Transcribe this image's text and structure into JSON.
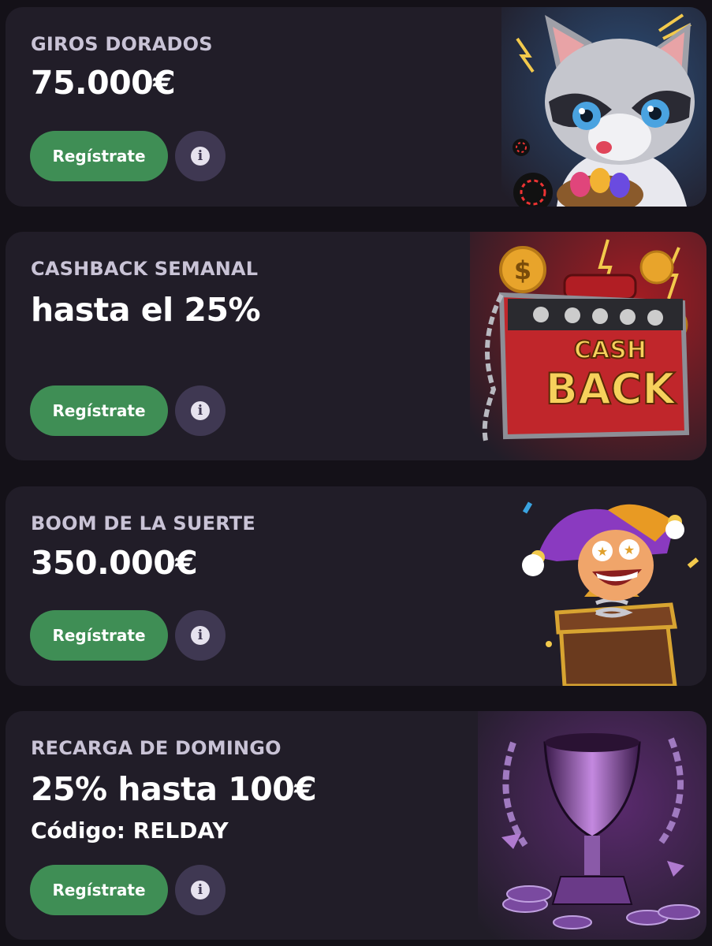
{
  "promos": [
    {
      "subtitle": "GIROS DORADOS",
      "amount": "75.000€",
      "button": "Regístrate",
      "illustration": "raccoon-illustration"
    },
    {
      "subtitle": "CASHBACK SEMANAL",
      "amount": "hasta el 25%",
      "button": "Regístrate",
      "illustration": "cashback-case-illustration",
      "art_text_1": "CASH",
      "art_text_2": "BACK"
    },
    {
      "subtitle": "BOOM DE LA SUERTE",
      "amount": "350.000€",
      "button": "Regístrate",
      "illustration": "jester-box-illustration"
    },
    {
      "subtitle": "RECARGA DE DOMINGO",
      "amount": "25% hasta 100€",
      "code": "Código: RELDAY",
      "button": "Regístrate",
      "illustration": "trophy-illustration"
    }
  ],
  "info_icon": "info-icon",
  "colors": {
    "background": "#141118",
    "card": "#211d28",
    "button": "#3f8e55",
    "info_button": "#3f3852",
    "subtitle": "#c9c3d6"
  }
}
